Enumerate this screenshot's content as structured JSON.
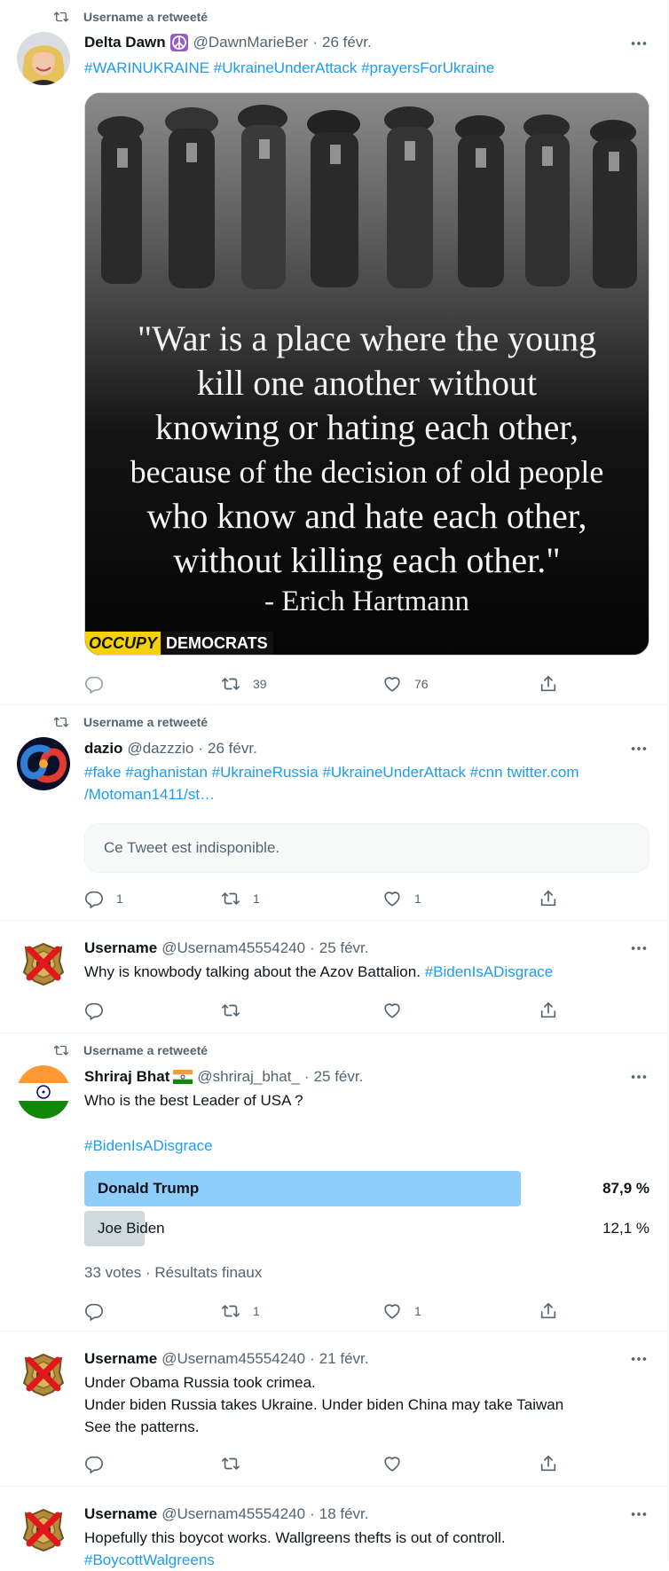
{
  "colors": {
    "link": "#1d9bf0",
    "secondary": "#536471",
    "poll_winner": "#8ecdf8",
    "poll_loser": "#cfd9de"
  },
  "tweets": [
    {
      "retweeted_label": "Username a retweeté",
      "name": "Delta Dawn",
      "badge_icon": "peace-emoji",
      "handle": "@DawnMarieBer",
      "date": "26 févr.",
      "hashtags": "#WARINUKRAINE #UkraineUnderAttack #prayersForUkraine",
      "image": {
        "quote_lines": [
          "\"War is a place where the young",
          "kill one another without",
          "knowing or hating each other,",
          "because of the decision of old people",
          "who know and hate each other,",
          "without killing each other.\""
        ],
        "author": "- Erich Hartmann",
        "brand_1": "OCCUPY",
        "brand_2": "DEMOCRATS"
      },
      "reply_count": "",
      "retweet_count": "39",
      "like_count": "76"
    },
    {
      "retweeted_label": "Username a retweeté",
      "name": "dazio",
      "handle": "@dazzzio",
      "date": "26 févr.",
      "text_line1": "#fake #aghanistan #UkraineRussia #UkraineUnderAttack #cnn twitter.com",
      "text_line2": "/Motoman1411/st…",
      "unavailable": "Ce Tweet est indisponible.",
      "reply_count": "1",
      "retweet_count": "1",
      "like_count": "1"
    },
    {
      "name": "Username",
      "handle": "@Usernam45554240",
      "date": "25 févr.",
      "text": "Why is knowbody talking about the Azov Battalion.",
      "hashtag": "#BidenIsADisgrace"
    },
    {
      "retweeted_label": "Username a retweeté",
      "name": "Shriraj Bhat",
      "badge_icon": "india-flag-emoji",
      "handle": "@shriraj_bhat_",
      "date": "25 févr.",
      "text": "Who is the best Leader of USA ?",
      "hashtag": "#BidenIsADisgrace",
      "poll": {
        "options": [
          {
            "label": "Donald Trump",
            "percent": "87,9 %",
            "fraction": 0.879,
            "winner": true
          },
          {
            "label": "Joe Biden",
            "percent": "12,1 %",
            "fraction": 0.121,
            "winner": false
          }
        ],
        "votes": "33 votes",
        "status": "Résultats finaux"
      },
      "reply_count": "",
      "retweet_count": "1",
      "like_count": "1"
    },
    {
      "name": "Username",
      "handle": "@Usernam45554240",
      "date": "21 févr.",
      "lines": [
        "Under Obama Russia took crimea.",
        "Under biden Russia takes Ukraine. Under biden China may take Taiwan",
        "See the patterns."
      ]
    },
    {
      "name": "Username",
      "handle": "@Usernam45554240",
      "date": "18 févr.",
      "text": "Hopefully this boycot works. Wallgreens thefts is out of controll.",
      "hashtag": "#BoycottWalgreens"
    }
  ]
}
